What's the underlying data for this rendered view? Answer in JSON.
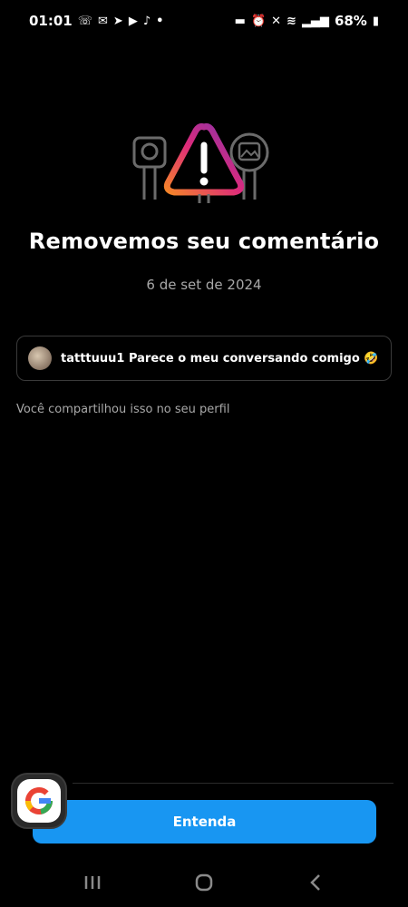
{
  "status_bar": {
    "time": "01:01",
    "battery": "68%",
    "left_icons": [
      "whatsapp-icon",
      "messenger-icon",
      "telegram-icon",
      "youtube-icon",
      "tiktok-icon",
      "dot-icon"
    ],
    "right_icons": [
      "bed-icon",
      "alarm-icon",
      "mute-icon",
      "wifi-icon",
      "signal-icon",
      "battery-icon"
    ]
  },
  "main": {
    "title": "Removemos seu comentário",
    "date": "6 de set de 2024",
    "comment": {
      "text": "tatttuuu1 Parece o meu conversando comigo 🤣"
    },
    "shared_note": "Você compartilhou isso no seu perfil",
    "button_label": "Entenda"
  },
  "colors": {
    "background": "#000000",
    "button": "#1896f2",
    "muted_text": "#a8a8a8",
    "gradient_start": "#f58529",
    "gradient_mid": "#dd2a7b",
    "gradient_end": "#8134af"
  },
  "icons": {
    "hero": "warning-triangle-icon",
    "floating": "google-icon",
    "nav": [
      "recent-apps-icon",
      "home-icon",
      "back-icon"
    ]
  }
}
